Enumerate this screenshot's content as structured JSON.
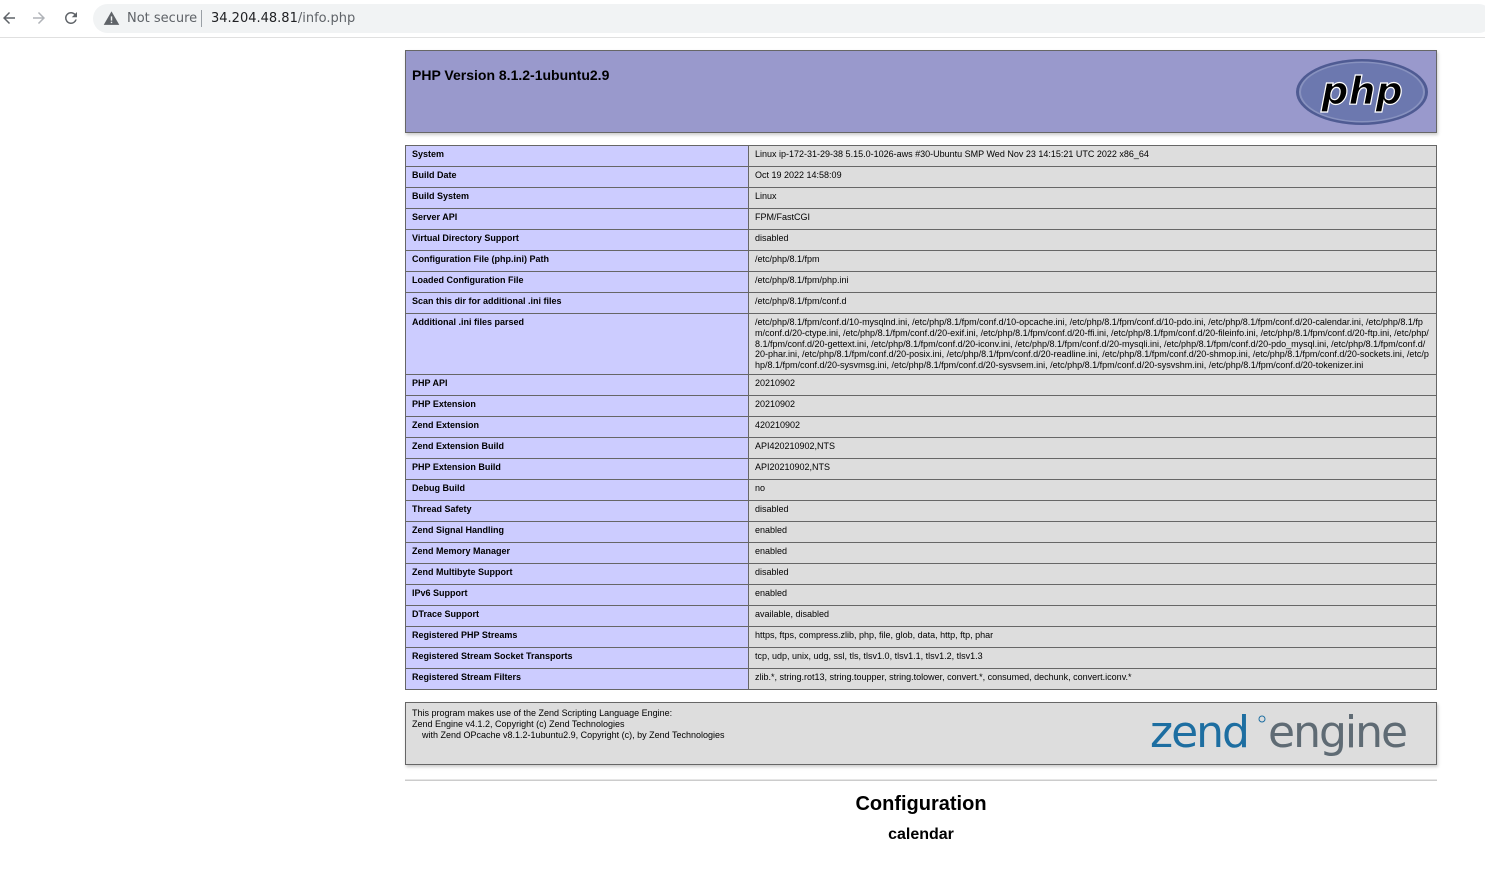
{
  "browser": {
    "security_label": "Not secure",
    "url_host": "34.204.48.81",
    "url_path": "/info.php"
  },
  "header": {
    "title": "PHP Version 8.1.2-1ubuntu2.9",
    "logo_text": "php"
  },
  "info_rows": [
    {
      "label": "System",
      "value": "Linux ip-172-31-29-38 5.15.0-1026-aws #30-Ubuntu SMP Wed Nov 23 14:15:21 UTC 2022 x86_64"
    },
    {
      "label": "Build Date",
      "value": "Oct 19 2022 14:58:09"
    },
    {
      "label": "Build System",
      "value": "Linux"
    },
    {
      "label": "Server API",
      "value": "FPM/FastCGI"
    },
    {
      "label": "Virtual Directory Support",
      "value": "disabled"
    },
    {
      "label": "Configuration File (php.ini) Path",
      "value": "/etc/php/8.1/fpm"
    },
    {
      "label": "Loaded Configuration File",
      "value": "/etc/php/8.1/fpm/php.ini"
    },
    {
      "label": "Scan this dir for additional .ini files",
      "value": "/etc/php/8.1/fpm/conf.d"
    },
    {
      "label": "Additional .ini files parsed",
      "value": "/etc/php/8.1/fpm/conf.d/10-mysqlnd.ini, /etc/php/8.1/fpm/conf.d/10-opcache.ini, /etc/php/8.1/fpm/conf.d/10-pdo.ini, /etc/php/8.1/fpm/conf.d/20-calendar.ini, /etc/php/8.1/fpm/conf.d/20-ctype.ini, /etc/php/8.1/fpm/conf.d/20-exif.ini, /etc/php/8.1/fpm/conf.d/20-ffi.ini, /etc/php/8.1/fpm/conf.d/20-fileinfo.ini, /etc/php/8.1/fpm/conf.d/20-ftp.ini, /etc/php/8.1/fpm/conf.d/20-gettext.ini, /etc/php/8.1/fpm/conf.d/20-iconv.ini, /etc/php/8.1/fpm/conf.d/20-mysqli.ini, /etc/php/8.1/fpm/conf.d/20-pdo_mysql.ini, /etc/php/8.1/fpm/conf.d/20-phar.ini, /etc/php/8.1/fpm/conf.d/20-posix.ini, /etc/php/8.1/fpm/conf.d/20-readline.ini, /etc/php/8.1/fpm/conf.d/20-shmop.ini, /etc/php/8.1/fpm/conf.d/20-sockets.ini, /etc/php/8.1/fpm/conf.d/20-sysvmsg.ini, /etc/php/8.1/fpm/conf.d/20-sysvsem.ini, /etc/php/8.1/fpm/conf.d/20-sysvshm.ini, /etc/php/8.1/fpm/conf.d/20-tokenizer.ini"
    },
    {
      "label": "PHP API",
      "value": "20210902"
    },
    {
      "label": "PHP Extension",
      "value": "20210902"
    },
    {
      "label": "Zend Extension",
      "value": "420210902"
    },
    {
      "label": "Zend Extension Build",
      "value": "API420210902,NTS"
    },
    {
      "label": "PHP Extension Build",
      "value": "API20210902,NTS"
    },
    {
      "label": "Debug Build",
      "value": "no"
    },
    {
      "label": "Thread Safety",
      "value": "disabled"
    },
    {
      "label": "Zend Signal Handling",
      "value": "enabled"
    },
    {
      "label": "Zend Memory Manager",
      "value": "enabled"
    },
    {
      "label": "Zend Multibyte Support",
      "value": "disabled"
    },
    {
      "label": "IPv6 Support",
      "value": "enabled"
    },
    {
      "label": "DTrace Support",
      "value": "available, disabled"
    },
    {
      "label": "Registered PHP Streams",
      "value": "https, ftps, compress.zlib, php, file, glob, data, http, ftp, phar"
    },
    {
      "label": "Registered Stream Socket Transports",
      "value": "tcp, udp, unix, udg, ssl, tls, tlsv1.0, tlsv1.1, tlsv1.2, tlsv1.3"
    },
    {
      "label": "Registered Stream Filters",
      "value": "zlib.*, string.rot13, string.toupper, string.tolower, convert.*, consumed, dechunk, convert.iconv.*"
    }
  ],
  "zend": {
    "line1": "This program makes use of the Zend Scripting Language Engine:",
    "line2": "Zend Engine v4.1.2, Copyright (c) Zend Technologies",
    "line3": "    with Zend OPcache v8.1.2-1ubuntu2.9, Copyright (c), by Zend Technologies",
    "logo_word1": "zend",
    "logo_word2": "engine"
  },
  "sections": {
    "configuration_heading": "Configuration",
    "first_module": "calendar"
  },
  "colors": {
    "header_bg": "#9999cc",
    "label_bg": "#ccccff",
    "value_bg": "#dddddd",
    "php_logo_bg": "#6c78af",
    "zend_blue": "#1d6ea1",
    "zend_gray": "#5f6b74"
  }
}
